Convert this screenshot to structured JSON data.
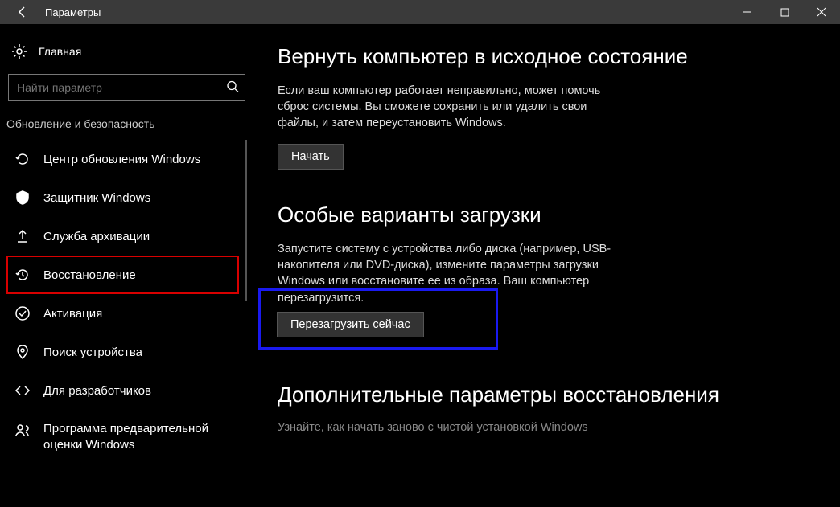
{
  "titlebar": {
    "title": "Параметры"
  },
  "sidebar": {
    "home_label": "Главная",
    "search_placeholder": "Найти параметр",
    "category_label": "Обновление и безопасность",
    "items": [
      {
        "label": "Центр обновления Windows"
      },
      {
        "label": "Защитник Windows"
      },
      {
        "label": "Служба архивации"
      },
      {
        "label": "Восстановление"
      },
      {
        "label": "Активация"
      },
      {
        "label": "Поиск устройства"
      },
      {
        "label": "Для разработчиков"
      },
      {
        "label": "Программа предварительной оценки Windows"
      }
    ]
  },
  "main": {
    "section1": {
      "heading": "Вернуть компьютер в исходное состояние",
      "text": "Если ваш компьютер работает неправильно, может помочь сброс системы. Вы сможете сохранить или удалить свои файлы, и затем переустановить Windows.",
      "button": "Начать"
    },
    "section2": {
      "heading": "Особые варианты загрузки",
      "text": "Запустите систему с устройства либо диска (например, USB-накопителя или DVD-диска), измените параметры загрузки Windows или восстановите ее из образа. Ваш компьютер перезагрузится.",
      "button": "Перезагрузить сейчас"
    },
    "section3": {
      "heading": "Дополнительные параметры восстановления",
      "text": "Узнайте, как начать заново с чистой установкой Windows"
    }
  }
}
